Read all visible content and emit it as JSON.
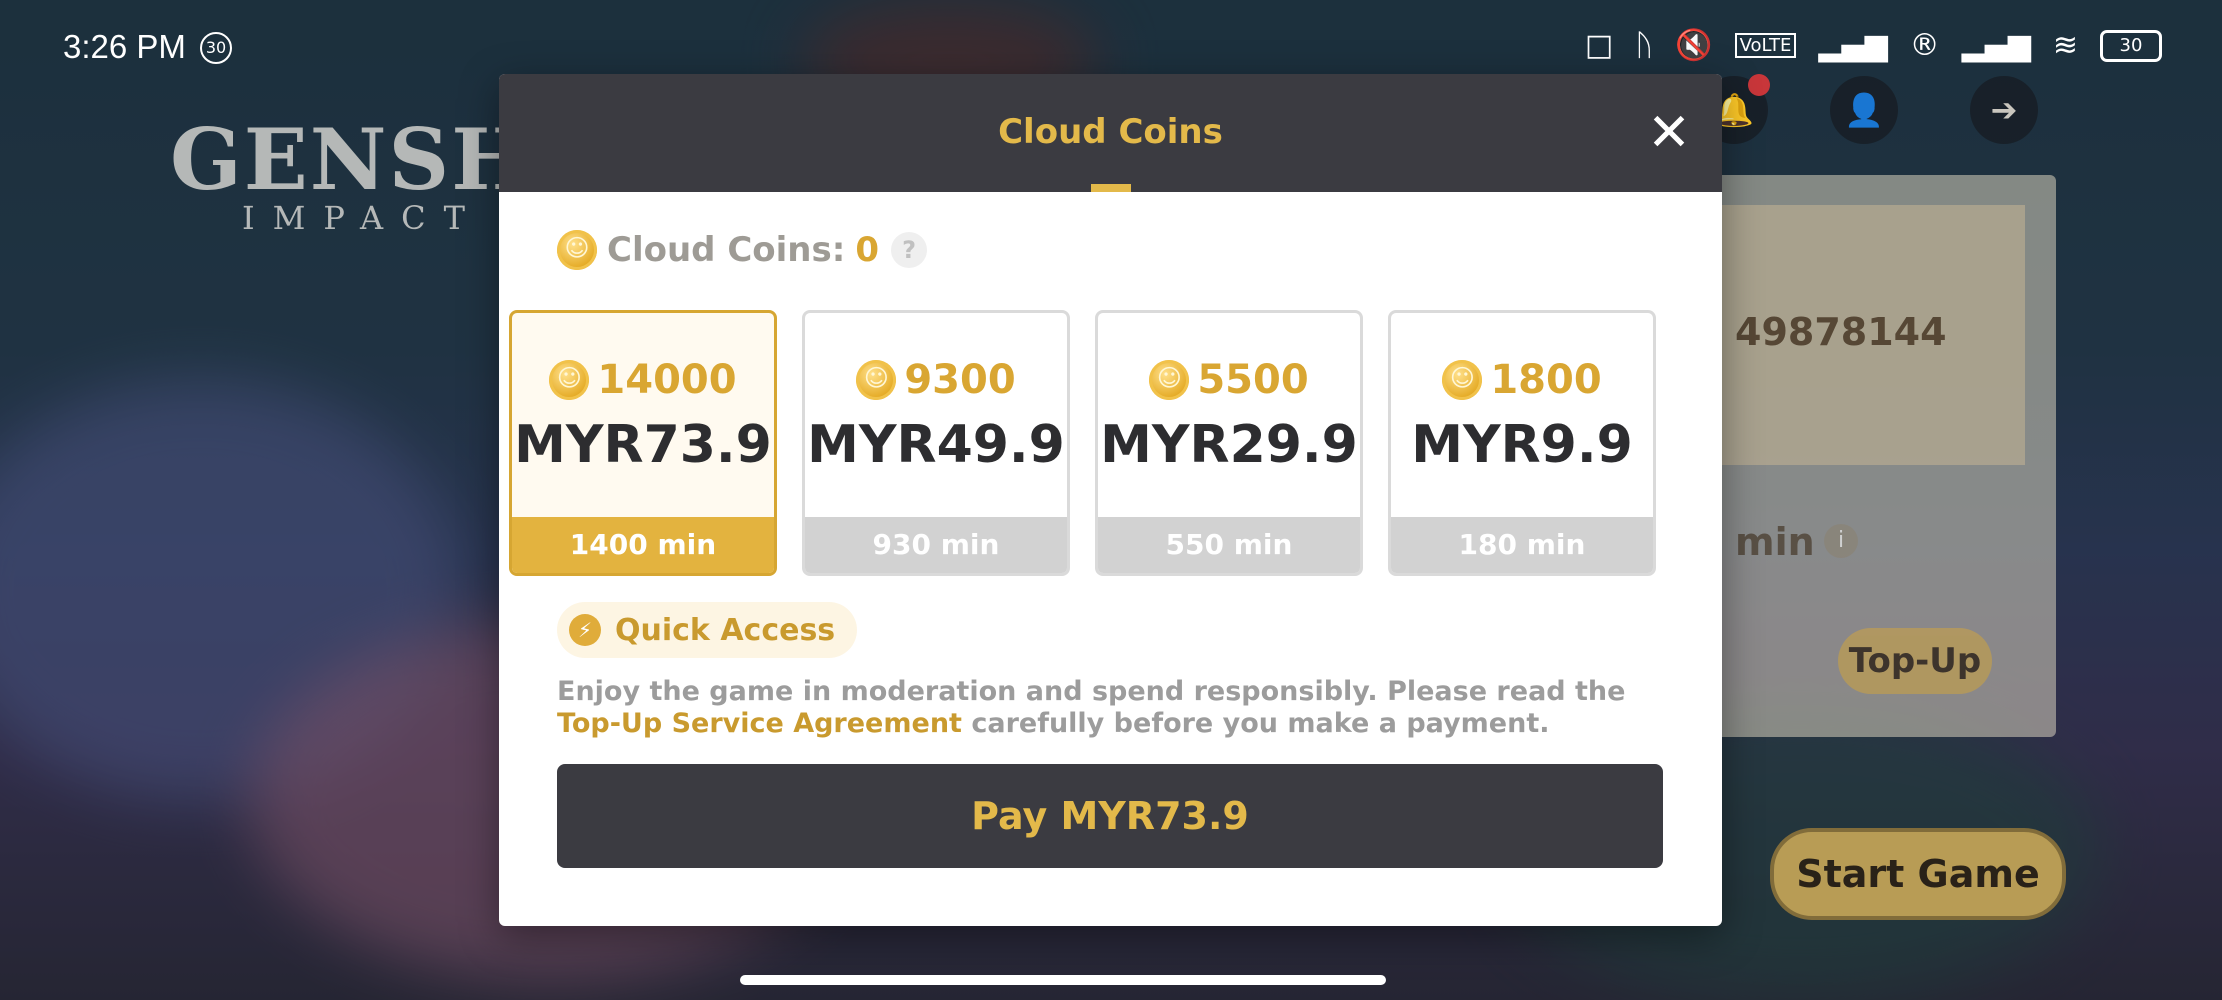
{
  "status_bar": {
    "time": "3:26 PM",
    "badge": "30",
    "icons": [
      "nfc-icon",
      "bluetooth-icon",
      "mute-icon",
      "volte-icon",
      "signal-icon",
      "roaming-icon",
      "signal-icon",
      "wifi-icon"
    ],
    "battery": "30"
  },
  "background": {
    "logo_main": "GENSHIN",
    "logo_sub": "IMPACT",
    "uid_fragment": "49878144",
    "minutes_fragment": "min",
    "topup_label": "Top-Up",
    "start_game_label": "Start Game"
  },
  "modal": {
    "title": "Cloud Coins",
    "balance_label": "Cloud Coins:",
    "balance_value": "0",
    "help_symbol": "?",
    "packages": [
      {
        "coins": "14000",
        "price": "MYR73.9",
        "minutes": "1400 min",
        "selected": true
      },
      {
        "coins": "9300",
        "price": "MYR49.9",
        "minutes": "930 min",
        "selected": false
      },
      {
        "coins": "5500",
        "price": "MYR29.9",
        "minutes": "550 min",
        "selected": false
      },
      {
        "coins": "1800",
        "price": "MYR9.9",
        "minutes": "180 min",
        "selected": false
      }
    ],
    "quick_access_label": "Quick Access",
    "notice_line1": "Enjoy the game in moderation and spend responsibly. Please read the",
    "notice_link": "Top-Up Service Agreement",
    "notice_line2": " carefully before you make a payment.",
    "pay_label": "Pay MYR73.9"
  },
  "colors": {
    "accent_gold": "#e3b94a",
    "header_dark": "#3b3b41",
    "selected_border": "#d6a632"
  }
}
